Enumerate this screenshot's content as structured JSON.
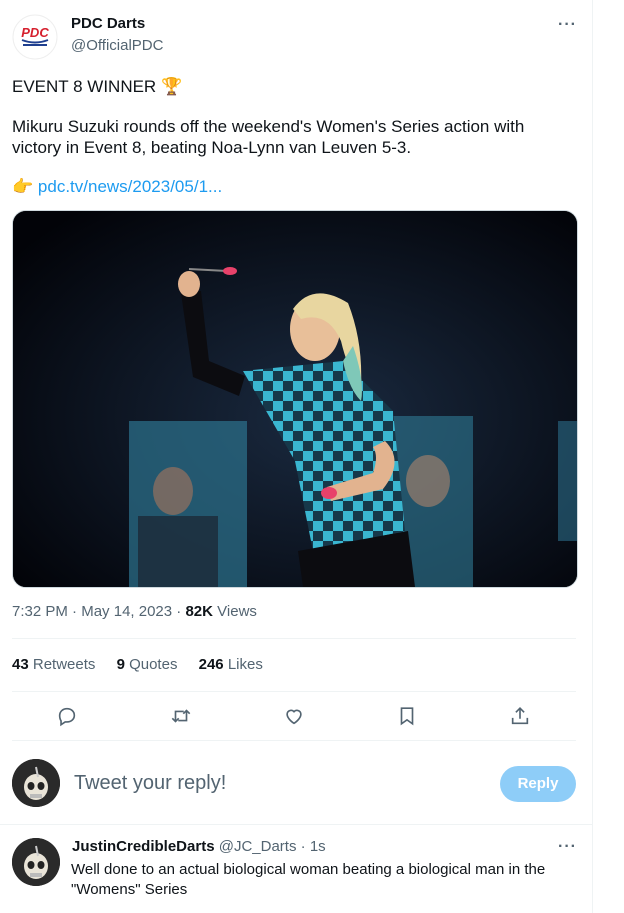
{
  "tweet": {
    "author_name": "PDC Darts",
    "author_handle": "@OfficialPDC",
    "headline": "EVENT 8 WINNER",
    "headline_emoji": "🏆",
    "body": "Mikuru Suzuki rounds off the weekend's Women's Series action with victory in Event 8, beating Noa-Lynn van Leuven 5-3.",
    "link_emoji": "👉",
    "link_text": "pdc.tv/news/2023/05/1...",
    "time": "7:32 PM",
    "date": "May 14, 2023",
    "views_count": "82K",
    "views_label": "Views",
    "more_label": "···"
  },
  "stats": {
    "retweets_count": "43",
    "retweets_label": "Retweets",
    "quotes_count": "9",
    "quotes_label": "Quotes",
    "likes_count": "246",
    "likes_label": "Likes"
  },
  "actions": [
    "reply-icon",
    "retweet-icon",
    "like-icon",
    "bookmark-icon",
    "share-icon"
  ],
  "compose": {
    "placeholder": "Tweet your reply!",
    "button": "Reply"
  },
  "reply": {
    "author_name": "JustinCredibleDarts",
    "author_handle": "@JC_Darts",
    "separator": "·",
    "time": "1s",
    "text": "Well done to an actual biological woman beating a biological man in the \"Womens\" Series",
    "more_label": "···"
  },
  "colors": {
    "accent": "#1d9bf0",
    "reply_button": "#8ecdf8",
    "secondary_text": "#536471"
  }
}
